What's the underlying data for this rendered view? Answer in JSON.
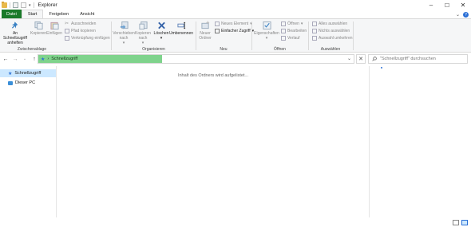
{
  "window": {
    "title": "Explorer"
  },
  "tabs": {
    "file": "Datei",
    "start": "Start",
    "share": "Freigeben",
    "view": "Ansicht"
  },
  "ribbon": {
    "clipboard": {
      "pin_label": "An Schnellzugriff anheften",
      "copy_label": "Kopieren",
      "paste_label": "Einfügen",
      "cut_label": "Ausschneiden",
      "copy_path_label": "Pfad kopieren",
      "paste_shortcut_label": "Verknüpfung einfügen",
      "group_label": "Zwischenablage"
    },
    "organize": {
      "move_label": "Verschieben nach",
      "copy_to_label": "Kopieren nach",
      "delete_label": "Löschen",
      "rename_label": "Umbenennen",
      "group_label": "Organisieren"
    },
    "new": {
      "new_folder_label": "Neuer Ordner",
      "new_item_label": "Neues Element",
      "easy_access_label": "Einfacher Zugriff",
      "group_label": "Neu"
    },
    "open": {
      "properties_label": "Eigenschaften",
      "open_label": "Öffnen",
      "edit_label": "Bearbeiten",
      "history_label": "Verlauf",
      "group_label": "Öffnen"
    },
    "select": {
      "select_all_label": "Alles auswählen",
      "select_none_label": "Nichts auswählen",
      "invert_label": "Auswahl umkehren",
      "group_label": "Auswählen"
    }
  },
  "address": {
    "path": "Schnellzugriff",
    "search_placeholder": "\"Schnellzugriff\" durchsuchen"
  },
  "nav": {
    "items": [
      {
        "label": "Schnellzugriff",
        "icon": "star-icon",
        "selected": true
      },
      {
        "label": "Dieser PC",
        "icon": "computer-icon",
        "selected": false
      }
    ]
  },
  "content": {
    "loading_text": "Inhalt des Ordners wird aufgelistet..."
  },
  "colors": {
    "file_tab": "#1a7a2a",
    "address_progress": "#7fd38c",
    "selection": "#cce8ff",
    "accent": "#2a6fd6"
  }
}
